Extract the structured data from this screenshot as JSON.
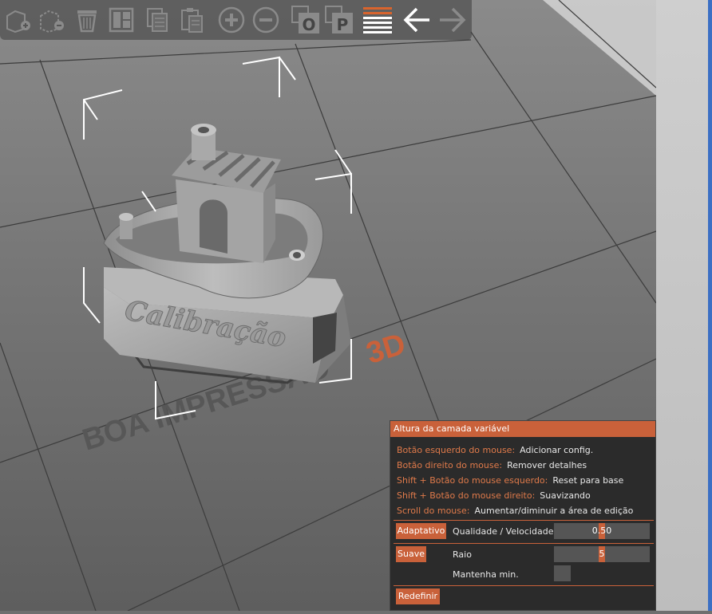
{
  "toolbar": {
    "items": [
      {
        "icon": "add-object-icon",
        "enabled": false
      },
      {
        "icon": "delete-object-icon",
        "enabled": false
      },
      {
        "icon": "delete-all-icon",
        "enabled": false
      },
      {
        "icon": "arrange-icon",
        "enabled": false
      },
      {
        "icon": "copy-icon",
        "enabled": false
      },
      {
        "icon": "paste-icon",
        "enabled": false
      },
      {
        "icon": "add-instance-icon",
        "enabled": false
      },
      {
        "icon": "remove-instance-icon",
        "enabled": false
      },
      {
        "icon": "split-to-objects-icon",
        "enabled": false
      },
      {
        "icon": "split-to-parts-icon",
        "enabled": false
      },
      {
        "icon": "variable-layer-height-icon",
        "enabled": true,
        "active": true
      },
      {
        "icon": "undo-icon",
        "enabled": true
      },
      {
        "icon": "redo-icon",
        "enabled": false
      }
    ]
  },
  "scene": {
    "watermark_main": "BOA IMPRESSÃO",
    "watermark_accent": "3D",
    "model_base_text": "Calibração"
  },
  "panel": {
    "title": "Altura da camada variável",
    "hints": [
      {
        "key": "Botão esquerdo do mouse:",
        "value": "Adicionar config."
      },
      {
        "key": "Botão direito do mouse:",
        "value": "Remover detalhes"
      },
      {
        "key": "Shift + Botão do mouse esquerdo:",
        "value": "Reset para base"
      },
      {
        "key": "Shift + Botão do mouse direito:",
        "value": "Suavizando"
      },
      {
        "key": "Scroll do mouse:",
        "value": "Aumentar/diminuir a área de edição"
      }
    ],
    "adaptive_button": "Adaptativo",
    "quality_label": "Qualidade / Velocidade",
    "quality_value": "0.50",
    "quality_fraction": 0.5,
    "smooth_button": "Suave",
    "radius_label": "Raio",
    "radius_value": "5",
    "radius_fraction": 0.5,
    "keep_min_label": "Mantenha min.",
    "keep_min_checked": false,
    "reset_button": "Redefinir"
  },
  "colors": {
    "accent": "#c9613a",
    "bed": "#6f6f6f",
    "panel_bg": "#2b2b2b"
  }
}
